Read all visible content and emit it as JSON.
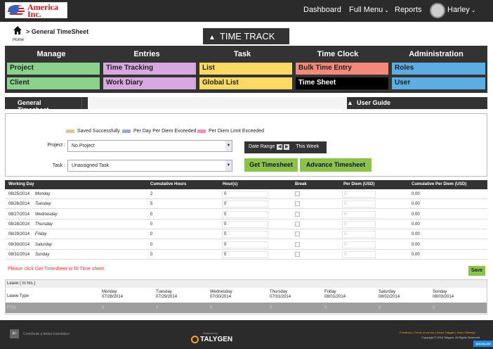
{
  "brand": {
    "name": "America Inc."
  },
  "topnav": {
    "dashboard": "Dashboard",
    "full_menu": "Full Menu",
    "reports": "Reports",
    "user": "Harley"
  },
  "breadcrumb": {
    "text": "> General TimeSheet",
    "home": "Home"
  },
  "module": {
    "title": "TIME TRACK"
  },
  "menu": {
    "headers": [
      "Manage",
      "Entries",
      "Task",
      "Time Clock",
      "Administration"
    ],
    "items": {
      "project": "Project",
      "client": "Client",
      "time_tracking": "Time Tracking",
      "work_diary": "Work Diary",
      "list": "List",
      "global_list": "Global List",
      "bulk_time_entry": "Bulk Time Entry",
      "time_sheet": "Time Sheet",
      "roles": "Roles",
      "user": "User"
    },
    "colors": {
      "manage": "#8cd18c",
      "entries": "#d8a8e0",
      "task": "#ffd966",
      "timeclock": "#f4887a",
      "timesheet": "#000000",
      "admin": "#5dade2"
    }
  },
  "tabs": {
    "general": "General Timesheet",
    "user_guide": "User Guide"
  },
  "legend": [
    {
      "label": "Saved Successfully",
      "color": "#d9c89a"
    },
    {
      "label": "Per Day Per Diem Exceeded",
      "color": "#9fa8da"
    },
    {
      "label": "Per Diem Limit Exceeded",
      "color": "#f48fb1"
    }
  ],
  "filters": {
    "project_label": "Project :",
    "project_value": "No Project",
    "task_label": "Task :",
    "task_value": "Unassigned Task",
    "date_range": "Date Range",
    "this_week": "This Week",
    "get_timesheet": "Get Timesheet",
    "advance_timesheet": "Advance Timesheet"
  },
  "grid": {
    "columns": [
      "Working Day",
      "Cumulative Hours",
      "Hour(s)",
      "Break",
      "Per Diem (USD)",
      "Cumulative Per Diem (USD)"
    ],
    "rows": [
      {
        "date": "08/25/2014",
        "day": "Monday",
        "cum": "2",
        "hours": "0",
        "per_diem": "0",
        "cum_diem": "0.00"
      },
      {
        "date": "08/26/2014",
        "day": "Tuesday",
        "cum": "5",
        "hours": "0",
        "per_diem": "0",
        "cum_diem": "0.00"
      },
      {
        "date": "08/27/2014",
        "day": "Wednesday",
        "cum": "0",
        "hours": "0",
        "per_diem": "0",
        "cum_diem": "0.00"
      },
      {
        "date": "08/28/2014",
        "day": "Thursday",
        "cum": "0",
        "hours": "0",
        "per_diem": "0",
        "cum_diem": "0.00"
      },
      {
        "date": "08/29/2014",
        "day": "Friday",
        "cum": "0",
        "hours": "0",
        "per_diem": "0",
        "cum_diem": "0.00"
      },
      {
        "date": "08/30/2014",
        "day": "Saturday",
        "cum": "0",
        "hours": "0",
        "per_diem": "0",
        "cum_diem": "0.00"
      },
      {
        "date": "08/31/2014",
        "day": "Sunday",
        "cum": "0",
        "hours": "0",
        "per_diem": "0",
        "cum_diem": "0.00"
      }
    ]
  },
  "message": "Please click Get Timesheet to fill Time sheet.",
  "save": "Save",
  "leave": {
    "title": "Leave ( In hrs.)",
    "type_label": "Leave Type",
    "days": [
      {
        "d": "Monday",
        "dt": "07/28/2014"
      },
      {
        "d": "Tuesday",
        "dt": "07/29/2014"
      },
      {
        "d": "Wednesday",
        "dt": "07/30/2014"
      },
      {
        "d": "Thursday",
        "dt": "07/31/2014"
      },
      {
        "d": "Friday",
        "dt": "08/01/2014"
      },
      {
        "d": "Saturday",
        "dt": "08/02/2014"
      },
      {
        "d": "Sunday",
        "dt": "08/03/2014"
      }
    ],
    "row": {
      "type": "PTO",
      "values": [
        "0",
        "0",
        "0",
        "0",
        "0",
        "0",
        "0"
      ]
    }
  },
  "footer": {
    "translate": "Contribute a better translation",
    "powered": "Powered by",
    "brand": "TALYGEN",
    "links": "Feedback | Terms of service | About Talygen | Help | Sitemap",
    "copyright": "Copyright © 2014 Talygen. All Rights Reserved.",
    "socialize": "SOCIALIZE"
  }
}
